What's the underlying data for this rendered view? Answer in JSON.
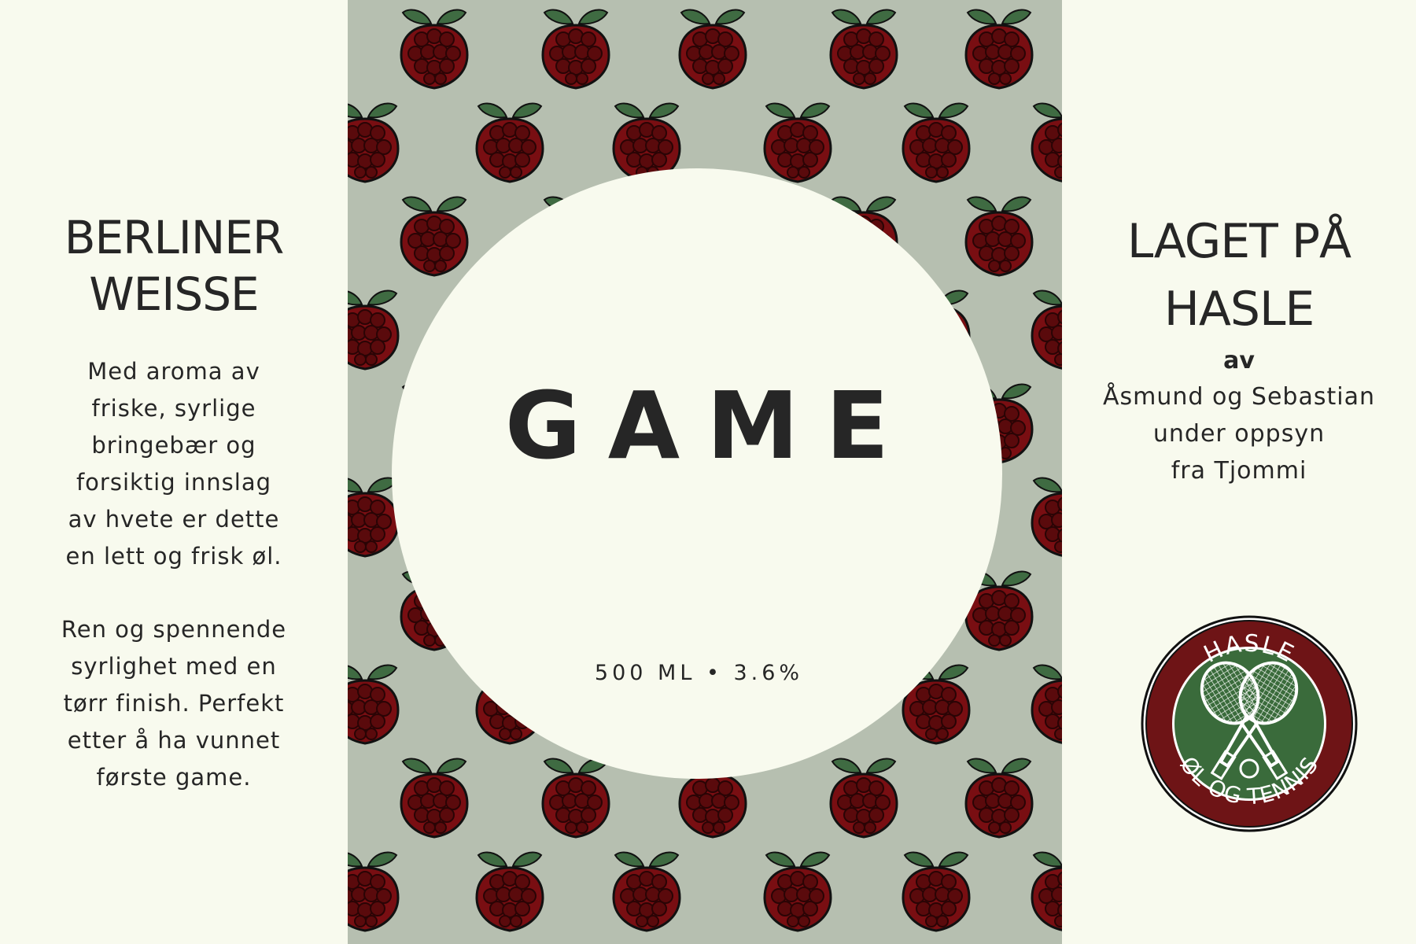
{
  "left": {
    "title_lines": [
      "BERLINER",
      "WEISSE"
    ],
    "description_1": [
      "Med aroma av",
      "friske, syrlige",
      "bringebær og",
      "forsiktig innslag",
      "av hvete er dette",
      "en lett og frisk øl."
    ],
    "description_2": [
      "Ren og spennende",
      "syrlighet med en",
      "tørr finish. Perfekt",
      "etter å ha vunnet",
      "første game."
    ]
  },
  "center": {
    "name": "GAME",
    "volume": "500 ML • 3.6%",
    "pattern_icon": "raspberry-icon"
  },
  "right": {
    "title_lines": [
      "LAGET PÅ",
      "HASLE"
    ],
    "by": "av",
    "credit_lines": [
      "Åsmund og Sebastian",
      "under oppsyn",
      "fra Tjommi"
    ],
    "logo": {
      "top_text": "HASLE",
      "bottom_text": "ØL OG TENNIS",
      "icon": "crossed-rackets-icon"
    }
  },
  "colors": {
    "background": "#f8faee",
    "pattern_background": "#b6bfb0",
    "raspberry": "#790e12",
    "raspberry_seeds": "#5a0a0c",
    "leaf": "#3f6b42",
    "text": "#262626",
    "logo_ring": "#6e1416",
    "logo_inner": "#3a6b3b"
  }
}
